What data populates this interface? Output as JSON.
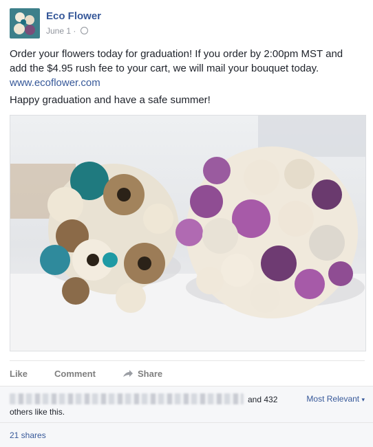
{
  "post": {
    "page_name": "Eco Flower",
    "date": "June 1",
    "separator": "·",
    "text_main": "Order your flowers today for graduation! If you order by 2:00pm MST and add the $4.95 rush fee to your cart, we will mail your bouquet today.",
    "link": "www.ecoflower.com",
    "text_second": "Happy graduation and have a safe summer!"
  },
  "actions": {
    "like": "Like",
    "comment": "Comment",
    "share": "Share"
  },
  "likes": {
    "suffix": "and 432",
    "others": "others like this.",
    "sort": "Most Relevant"
  },
  "shares": {
    "label": "21 shares"
  },
  "icons": [
    "avatar-logo",
    "globe-icon",
    "share-arrow-icon",
    "dropdown-caret-icon"
  ],
  "colors": {
    "link": "#365899",
    "text": "#1d2129",
    "muted": "#90949c"
  }
}
